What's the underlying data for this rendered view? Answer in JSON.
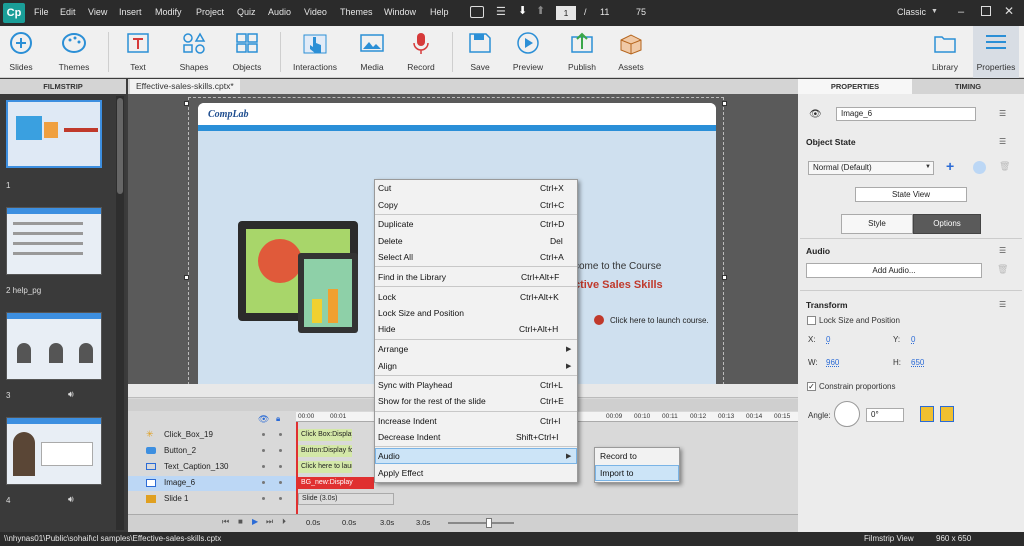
{
  "app": {
    "logo": "Cp"
  },
  "menu": [
    "File",
    "Edit",
    "View",
    "Insert",
    "Modify",
    "Project",
    "Quiz",
    "Audio",
    "Video",
    "Themes",
    "Window",
    "Help"
  ],
  "nav": {
    "current_page": "1",
    "separator": "/",
    "total_pages": "11",
    "zoom": "75",
    "workspace": "Classic"
  },
  "toolbar": {
    "slides": "Slides",
    "themes": "Themes",
    "text": "Text",
    "shapes": "Shapes",
    "objects": "Objects",
    "interactions": "Interactions",
    "media": "Media",
    "record": "Record",
    "save": "Save",
    "preview": "Preview",
    "publish": "Publish",
    "assets": "Assets",
    "library": "Library",
    "properties": "Properties"
  },
  "filmstrip": {
    "header": "FILMSTRIP",
    "slides": [
      {
        "label": "1"
      },
      {
        "label": "2 help_pg"
      },
      {
        "label": "3"
      },
      {
        "label": "4"
      }
    ]
  },
  "document": {
    "tab_title": "Effective-sales-skills.cptx*"
  },
  "slide": {
    "logo": "CompLab",
    "welcome": "come to the Course",
    "course": "ctive Sales Skills",
    "launch": "Click here to launch course."
  },
  "context_menu": {
    "items": [
      {
        "label": "Cut",
        "shortcut": "Ctrl+X"
      },
      {
        "label": "Copy",
        "shortcut": "Ctrl+C"
      },
      {
        "label": "Duplicate",
        "shortcut": "Ctrl+D"
      },
      {
        "label": "Delete",
        "shortcut": "Del"
      },
      {
        "label": "Select All",
        "shortcut": "Ctrl+A"
      },
      {
        "label": "Find in the Library",
        "shortcut": "Ctrl+Alt+F"
      },
      {
        "label": "Lock",
        "shortcut": "Ctrl+Alt+K"
      },
      {
        "label": "Lock Size and Position",
        "shortcut": ""
      },
      {
        "label": "Hide",
        "shortcut": "Ctrl+Alt+H"
      },
      {
        "label": "Arrange",
        "shortcut": ""
      },
      {
        "label": "Align",
        "shortcut": ""
      },
      {
        "label": "Sync with Playhead",
        "shortcut": "Ctrl+L"
      },
      {
        "label": "Show for the rest of the slide",
        "shortcut": "Ctrl+E"
      },
      {
        "label": "Increase Indent",
        "shortcut": "Ctrl+I"
      },
      {
        "label": "Decrease Indent",
        "shortcut": "Shift+Ctrl+I"
      },
      {
        "label": "Audio",
        "shortcut": ""
      },
      {
        "label": "Apply Effect",
        "shortcut": ""
      }
    ],
    "submenu": [
      "Record to",
      "Import to"
    ]
  },
  "timeline": {
    "rows": [
      {
        "name": "Click_Box_19",
        "bar": "Click Box:Display"
      },
      {
        "name": "Button_2",
        "bar": "Button:Display fo"
      },
      {
        "name": "Text_Caption_130",
        "bar": "Click here to laun"
      },
      {
        "name": "Image_6",
        "bar": "BG_new:Display"
      },
      {
        "name": "Slide 1",
        "bar": "Slide (3.0s)"
      }
    ],
    "ruler_start": "00:00",
    "ruler_mark": "00:01",
    "ruler_marks_right": [
      "00:09",
      "00:10",
      "00:11",
      "00:12",
      "00:13",
      "00:14",
      "00:15"
    ],
    "times": [
      "0.0s",
      "0.0s",
      "3.0s",
      "3.0s"
    ]
  },
  "properties": {
    "tab_properties": "PROPERTIES",
    "tab_timing": "TIMING",
    "object_name": "Image_6",
    "object_state_label": "Object State",
    "state_value": "Normal (Default)",
    "state_view": "State View",
    "style_tab": "Style",
    "options_tab": "Options",
    "audio_label": "Audio",
    "add_audio": "Add Audio...",
    "transform_label": "Transform",
    "lock_size": "Lock Size and Position",
    "x_label": "X:",
    "x_value": "0",
    "y_label": "Y:",
    "y_value": "0",
    "w_label": "W:",
    "w_value": "960",
    "h_label": "H:",
    "h_value": "650",
    "constrain": "Constrain proportions",
    "angle_label": "Angle:",
    "angle_value": "0°"
  },
  "status": {
    "path": "\\\\nhynas01\\Public\\sohail\\cl samples\\Effective-sales-skills.cptx",
    "view": "Filmstrip View",
    "size": "960 x 650"
  }
}
